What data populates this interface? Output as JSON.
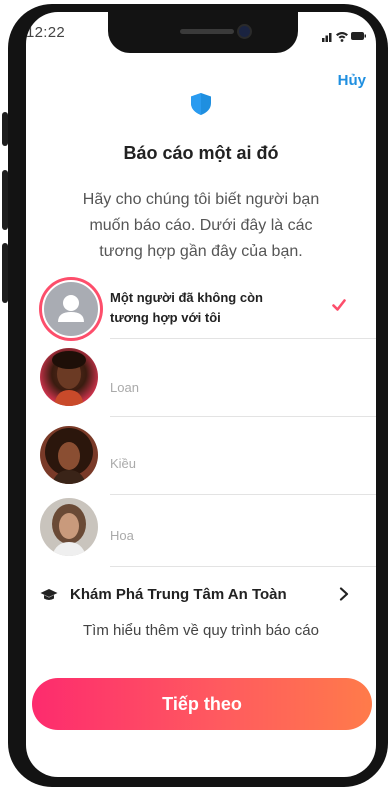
{
  "status_bar": {
    "time": "12:22"
  },
  "header": {
    "cancel_label": "Hủy",
    "title": "Báo cáo một ai đó"
  },
  "description": "Hãy cho chúng tôi biết người bạn muốn báo cáo. Dưới đây là các tương hợp gần đây của bạn.",
  "options": [
    {
      "label": "Một người đã không còn tương hợp với tôi",
      "selected": true
    },
    {
      "label": "Loan",
      "selected": false
    },
    {
      "label": "Kiều",
      "selected": false
    },
    {
      "label": "Hoa",
      "selected": false
    }
  ],
  "safety": {
    "title": "Khám Phá Trung Tâm An Toàn",
    "subtitle": "Tìm hiểu thêm về quy trình báo cáo",
    "icon": "graduation-cap-icon"
  },
  "next_button": {
    "label": "Tiếp theo"
  },
  "colors": {
    "accent_blue": "#1f8fe0",
    "brand_pink": "#fd4e6b",
    "gradient_start": "#fd2b6e",
    "gradient_end": "#ff7b4a"
  }
}
